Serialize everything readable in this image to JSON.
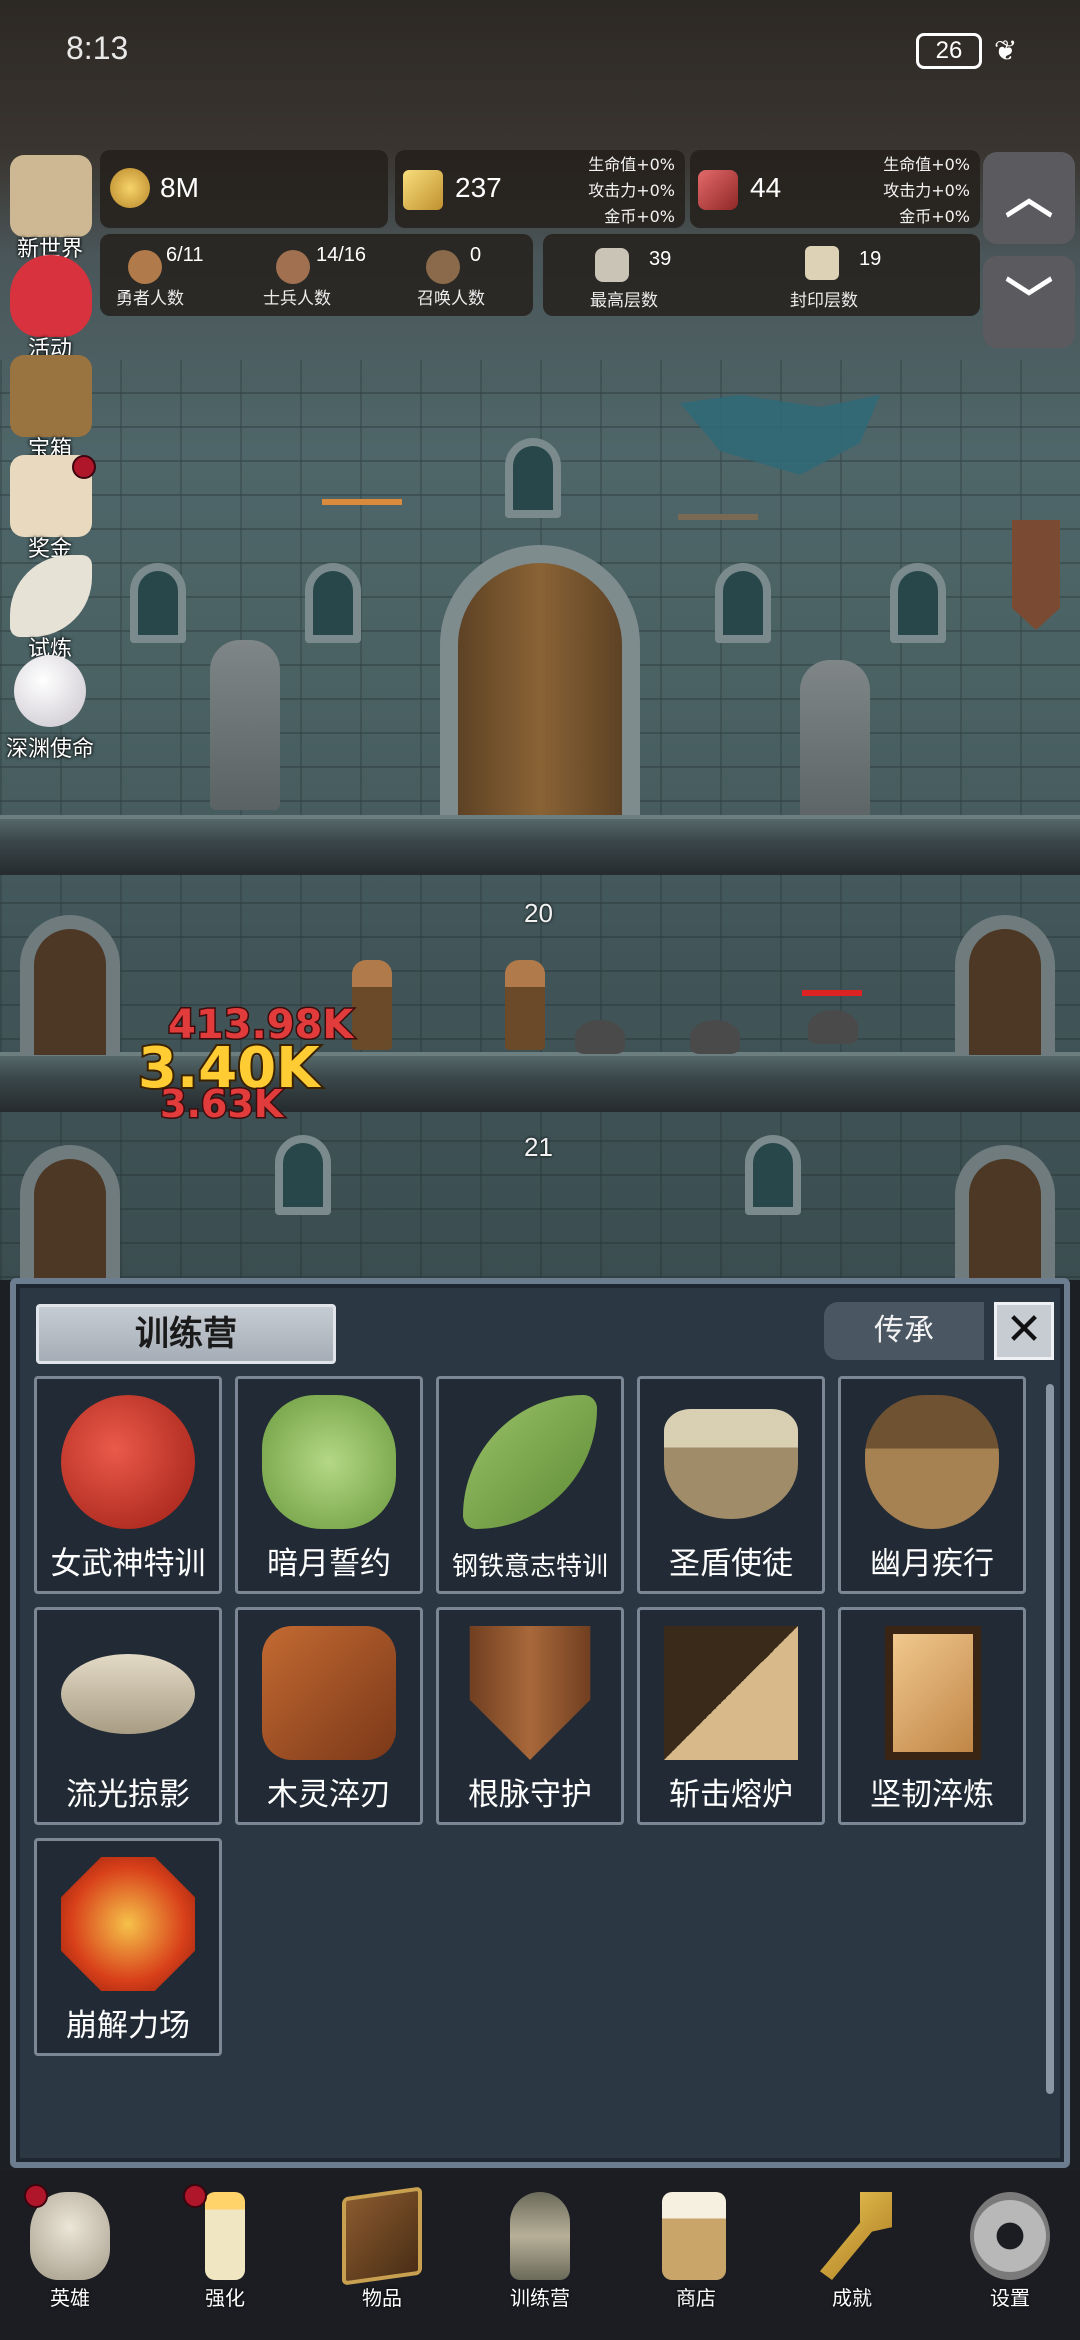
{
  "status_bar": {
    "time": "8:13",
    "battery": "26"
  },
  "resources": {
    "gold": {
      "value": "8M"
    },
    "gold_bar": {
      "value": "237",
      "bonuses": [
        "生命值+0%",
        "攻击力+0%",
        "金币+0%"
      ]
    },
    "gem": {
      "value": "44",
      "bonuses": [
        "生命值+0%",
        "攻击力+0%",
        "金币+0%"
      ]
    }
  },
  "counts": {
    "heroes": {
      "value": "6/11",
      "label": "勇者人数"
    },
    "soldiers": {
      "value": "14/16",
      "label": "士兵人数"
    },
    "summons": {
      "value": "0",
      "label": "召唤人数"
    },
    "max_floor": {
      "value": "39",
      "label": "最高层数"
    },
    "sealed_floor": {
      "value": "19",
      "label": "封印层数"
    }
  },
  "side_menu": [
    {
      "label": "新世界",
      "icon": "map-icon",
      "color": "#cdb893",
      "dot": false
    },
    {
      "label": "活动",
      "icon": "heart-icon",
      "color": "#d8323e",
      "dot": false
    },
    {
      "label": "宝箱",
      "icon": "chest-icon",
      "color": "#9a7440",
      "dot": false
    },
    {
      "label": "奖金",
      "icon": "envelope-icon",
      "color": "#e8d9bf",
      "dot": true
    },
    {
      "label": "试炼",
      "icon": "feather-icon",
      "color": "#e6e2d6",
      "dot": false
    },
    {
      "label": "深渊使命",
      "icon": "pearl-icon",
      "color": "#e9e6ea",
      "dot": false
    }
  ],
  "scene": {
    "floor_numbers": [
      "20",
      "21"
    ],
    "damage_texts": [
      "413.98K",
      "3.40K",
      "3.63K"
    ]
  },
  "modal": {
    "title": "训练营",
    "inherit_label": "传承",
    "close_label": "✕",
    "items": [
      {
        "label": "女武神特训",
        "icon": "apple-icon",
        "color": "#c7291e"
      },
      {
        "label": "暗月誓约",
        "icon": "cabbage-icon",
        "color": "#8dbb62"
      },
      {
        "label": "钢铁意志特训",
        "icon": "leaf-icon",
        "color": "#79a84a"
      },
      {
        "label": "圣盾使徒",
        "icon": "bowl-icon",
        "color": "#b3a88a"
      },
      {
        "label": "幽月疾行",
        "icon": "acorn-icon",
        "color": "#8a6b3e"
      },
      {
        "label": "流光掠影",
        "icon": "fish-icon",
        "color": "#c8bca2"
      },
      {
        "label": "木灵淬刃",
        "icon": "log-icon",
        "color": "#a8572a"
      },
      {
        "label": "根脉守护",
        "icon": "shield-icon",
        "color": "#8b4f2b"
      },
      {
        "label": "斩击熔炉",
        "icon": "block-icon",
        "color": "#6a5438"
      },
      {
        "label": "坚韧淬炼",
        "icon": "board-icon",
        "color": "#d9a56a"
      },
      {
        "label": "崩解力场",
        "icon": "lava-icon",
        "color": "#e15a1a"
      }
    ]
  },
  "bottom_nav": [
    {
      "label": "英雄",
      "icon": "skull-icon",
      "color": "#d9d2c4",
      "dot": true
    },
    {
      "label": "强化",
      "icon": "candle-icon",
      "color": "#f0e6c2",
      "dot": true
    },
    {
      "label": "物品",
      "icon": "book-icon",
      "color": "#6b4a2a",
      "dot": false
    },
    {
      "label": "训练营",
      "icon": "lantern-icon",
      "color": "#8c8c7a",
      "dot": false
    },
    {
      "label": "商店",
      "icon": "beer-icon",
      "color": "#c9a56a",
      "dot": false
    },
    {
      "label": "成就",
      "icon": "key-icon",
      "color": "#d8a93a",
      "dot": false
    },
    {
      "label": "设置",
      "icon": "gear-icon",
      "color": "#a0a0a0",
      "dot": false
    }
  ]
}
